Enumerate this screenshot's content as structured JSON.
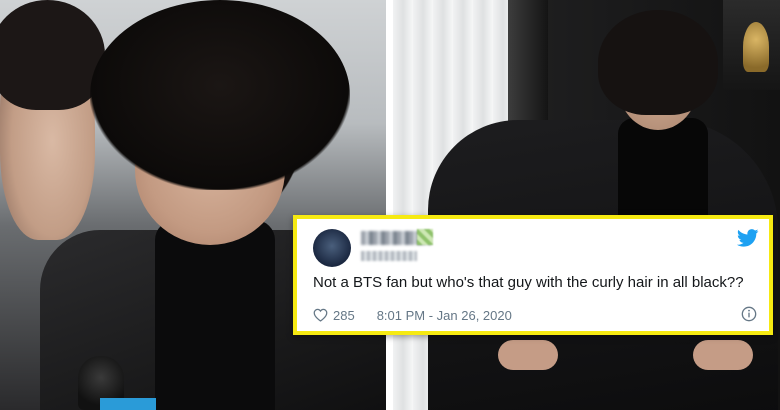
{
  "tweet": {
    "text": "Not a BTS fan but who's that guy with the curly hair in all black??",
    "likes": "285",
    "timestamp": "8:01 PM - Jan 26, 2020"
  },
  "icons": {
    "brand": "twitter-bird-icon",
    "like": "heart-icon",
    "info": "info-icon"
  },
  "colors": {
    "card_border": "#f6ea12",
    "twitter_blue": "#1da1f2",
    "text": "#14171a",
    "meta": "#657786"
  }
}
